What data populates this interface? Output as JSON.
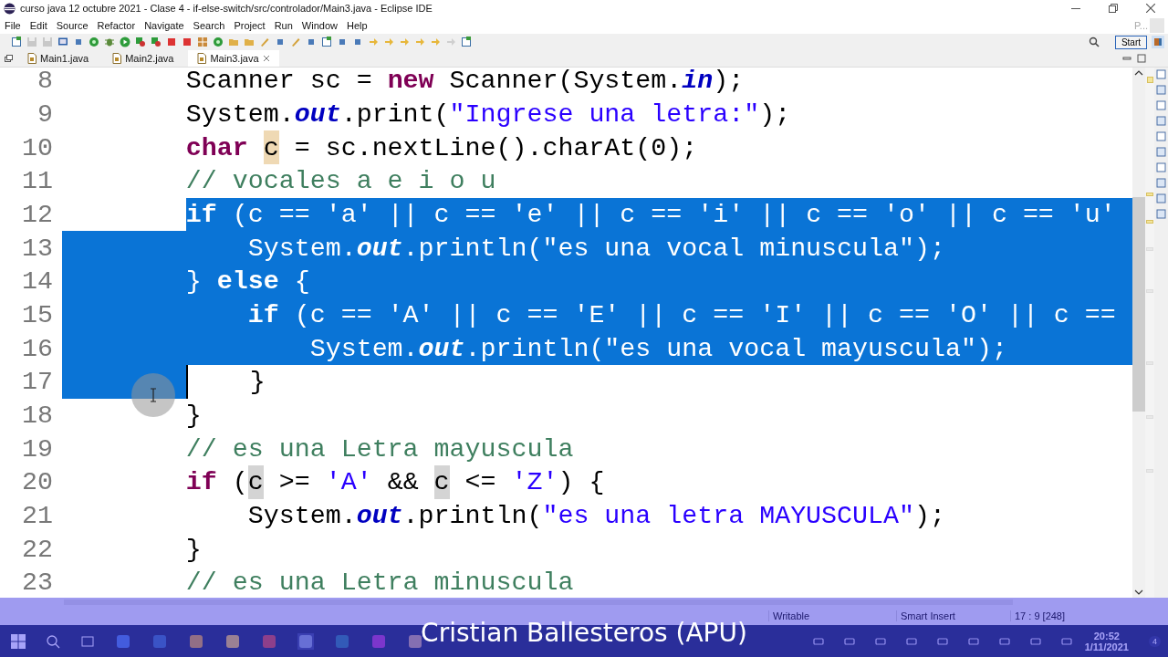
{
  "window": {
    "title": "curso java 12 octubre 2021 - Clase 4 - if-else-switch/src/controlador/Main3.java - Eclipse IDE"
  },
  "menu": [
    "File",
    "Edit",
    "Source",
    "Refactor",
    "Navigate",
    "Search",
    "Project",
    "Run",
    "Window",
    "Help"
  ],
  "toolbar_right": {
    "hint": "P...",
    "start_button": "Start"
  },
  "tabs": [
    {
      "label": "Main1.java",
      "selected": false
    },
    {
      "label": "Main2.java",
      "selected": false
    },
    {
      "label": "Main3.java",
      "selected": true
    }
  ],
  "editor": {
    "lines": [
      {
        "number": "8",
        "indent_selected": false,
        "eol_selected": false,
        "caret": false,
        "tokens": [
          {
            "kind": "plain",
            "text": "        Scanner sc = ",
            "selected": false
          },
          {
            "kind": "keyword",
            "text": "new",
            "selected": false
          },
          {
            "kind": "plain",
            "text": " Scanner(System.",
            "selected": false
          },
          {
            "kind": "field",
            "text": "in",
            "selected": false
          },
          {
            "kind": "plain",
            "text": ");",
            "selected": false
          }
        ]
      },
      {
        "number": "9",
        "indent_selected": false,
        "eol_selected": false,
        "caret": false,
        "tokens": [
          {
            "kind": "plain",
            "text": "        System.",
            "selected": false
          },
          {
            "kind": "field",
            "text": "out",
            "selected": false
          },
          {
            "kind": "plain",
            "text": ".print(",
            "selected": false
          },
          {
            "kind": "string",
            "text": "\"Ingrese una letra:\"",
            "selected": false
          },
          {
            "kind": "plain",
            "text": ");",
            "selected": false
          }
        ]
      },
      {
        "number": "10",
        "indent_selected": false,
        "eol_selected": false,
        "caret": false,
        "tokens": [
          {
            "kind": "keyword",
            "text": "        char ",
            "selected": false
          },
          {
            "kind": "write_occurrence",
            "text": "c",
            "selected": false
          },
          {
            "kind": "plain",
            "text": " = sc.nextLine().charAt(0);",
            "selected": false
          }
        ]
      },
      {
        "number": "11",
        "indent_selected": false,
        "eol_selected": false,
        "caret": false,
        "tokens": [
          {
            "kind": "comment",
            "text": "        // vocales a e i o u",
            "selected": false
          }
        ]
      },
      {
        "number": "12",
        "indent_selected": false,
        "eol_selected": true,
        "caret": false,
        "tokens": [
          {
            "kind": "keyword",
            "text": "        if",
            "selected": true
          },
          {
            "kind": "plain",
            "text": " (c == ",
            "selected": true
          },
          {
            "kind": "string",
            "text": "'a'",
            "selected": true
          },
          {
            "kind": "plain",
            "text": " || c == ",
            "selected": true
          },
          {
            "kind": "string",
            "text": "'e'",
            "selected": true
          },
          {
            "kind": "plain",
            "text": " || c == ",
            "selected": true
          },
          {
            "kind": "string",
            "text": "'i'",
            "selected": true
          },
          {
            "kind": "plain",
            "text": " || c == ",
            "selected": true
          },
          {
            "kind": "string",
            "text": "'o'",
            "selected": true
          },
          {
            "kind": "plain",
            "text": " || c == ",
            "selected": true
          },
          {
            "kind": "string",
            "text": "'u'",
            "selected": true
          }
        ]
      },
      {
        "number": "13",
        "indent_selected": true,
        "eol_selected": true,
        "caret": false,
        "tokens": [
          {
            "kind": "plain",
            "text": "            System.",
            "selected": true
          },
          {
            "kind": "field",
            "text": "out",
            "selected": true
          },
          {
            "kind": "plain",
            "text": ".println(",
            "selected": true
          },
          {
            "kind": "string",
            "text": "\"es una vocal minuscula\"",
            "selected": true
          },
          {
            "kind": "plain",
            "text": ");",
            "selected": true
          }
        ]
      },
      {
        "number": "14",
        "indent_selected": true,
        "eol_selected": true,
        "caret": false,
        "tokens": [
          {
            "kind": "plain",
            "text": "        } ",
            "selected": true
          },
          {
            "kind": "keyword",
            "text": "else",
            "selected": true
          },
          {
            "kind": "plain",
            "text": " {",
            "selected": true
          }
        ]
      },
      {
        "number": "15",
        "indent_selected": true,
        "eol_selected": true,
        "caret": false,
        "tokens": [
          {
            "kind": "keyword",
            "text": "            if",
            "selected": true
          },
          {
            "kind": "plain",
            "text": " (c == ",
            "selected": true
          },
          {
            "kind": "string",
            "text": "'A'",
            "selected": true
          },
          {
            "kind": "plain",
            "text": " || c == ",
            "selected": true
          },
          {
            "kind": "string",
            "text": "'E'",
            "selected": true
          },
          {
            "kind": "plain",
            "text": " || c == ",
            "selected": true
          },
          {
            "kind": "string",
            "text": "'I'",
            "selected": true
          },
          {
            "kind": "plain",
            "text": " || c == ",
            "selected": true
          },
          {
            "kind": "string",
            "text": "'O'",
            "selected": true
          },
          {
            "kind": "plain",
            "text": " || c ==",
            "selected": true
          }
        ]
      },
      {
        "number": "16",
        "indent_selected": true,
        "eol_selected": true,
        "caret": false,
        "tokens": [
          {
            "kind": "plain",
            "text": "                System.",
            "selected": true
          },
          {
            "kind": "field",
            "text": "out",
            "selected": true
          },
          {
            "kind": "plain",
            "text": ".println(",
            "selected": true
          },
          {
            "kind": "string",
            "text": "\"es una vocal mayuscula\"",
            "selected": true
          },
          {
            "kind": "plain",
            "text": ");",
            "selected": true
          }
        ]
      },
      {
        "number": "17",
        "indent_selected": true,
        "eol_selected": false,
        "caret": true,
        "tokens": [
          {
            "kind": "plain",
            "text": "            }",
            "selected": false
          }
        ]
      },
      {
        "number": "18",
        "indent_selected": false,
        "eol_selected": false,
        "caret": false,
        "tokens": [
          {
            "kind": "plain",
            "text": "        }",
            "selected": false
          }
        ]
      },
      {
        "number": "19",
        "indent_selected": false,
        "eol_selected": false,
        "caret": false,
        "tokens": [
          {
            "kind": "comment",
            "text": "        // es una Letra mayuscula",
            "selected": false
          }
        ]
      },
      {
        "number": "20",
        "indent_selected": false,
        "eol_selected": false,
        "caret": false,
        "tokens": [
          {
            "kind": "keyword",
            "text": "        if",
            "selected": false
          },
          {
            "kind": "plain",
            "text": " (",
            "selected": false
          },
          {
            "kind": "read_occurrence",
            "text": "c",
            "selected": false
          },
          {
            "kind": "plain",
            "text": " >= ",
            "selected": false
          },
          {
            "kind": "string",
            "text": "'A'",
            "selected": false
          },
          {
            "kind": "plain",
            "text": " && ",
            "selected": false
          },
          {
            "kind": "read_occurrence",
            "text": "c",
            "selected": false
          },
          {
            "kind": "plain",
            "text": " <= ",
            "selected": false
          },
          {
            "kind": "string",
            "text": "'Z'",
            "selected": false
          },
          {
            "kind": "plain",
            "text": ") {",
            "selected": false
          }
        ]
      },
      {
        "number": "21",
        "indent_selected": false,
        "eol_selected": false,
        "caret": false,
        "tokens": [
          {
            "kind": "plain",
            "text": "            System.",
            "selected": false
          },
          {
            "kind": "field",
            "text": "out",
            "selected": false
          },
          {
            "kind": "plain",
            "text": ".println(",
            "selected": false
          },
          {
            "kind": "string",
            "text": "\"es una letra MAYUSCULA\"",
            "selected": false
          },
          {
            "kind": "plain",
            "text": ");",
            "selected": false
          }
        ]
      },
      {
        "number": "22",
        "indent_selected": false,
        "eol_selected": false,
        "caret": false,
        "tokens": [
          {
            "kind": "plain",
            "text": "        }",
            "selected": false
          }
        ]
      },
      {
        "number": "23",
        "indent_selected": false,
        "eol_selected": false,
        "caret": false,
        "tokens": [
          {
            "kind": "comment",
            "text": "        // es una Letra minuscula",
            "selected": false
          }
        ]
      }
    ]
  },
  "status_bar": {
    "mode": "Writable",
    "insert_mode": "Smart Insert",
    "position": "17 : 9 [248]"
  },
  "taskbar": {
    "time": "20:52",
    "date": "1/11/2021",
    "notifications": "4"
  },
  "caption": "Cristian Ballesteros (APU)"
}
